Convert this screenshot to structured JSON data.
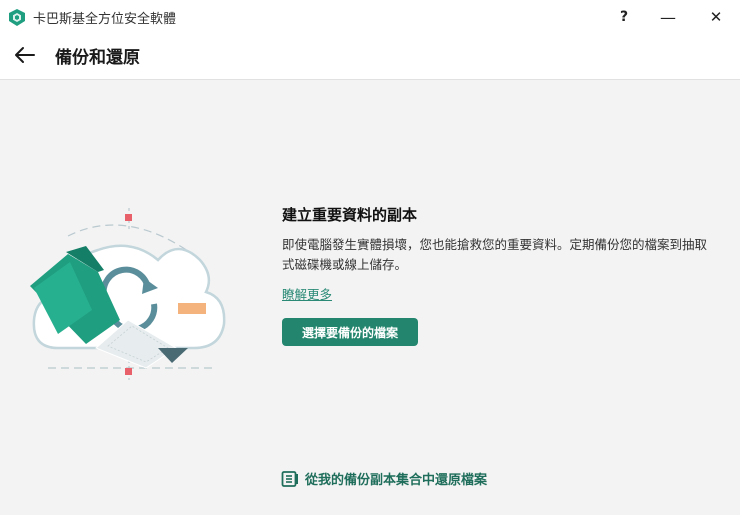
{
  "window": {
    "title": "卡巴斯基全方位安全軟體",
    "help_label": "?",
    "minimize_label": "—",
    "close_label": "✕"
  },
  "header": {
    "title": "備份和還原",
    "back_icon": "arrow-left-icon"
  },
  "main": {
    "heading": "建立重要資料的副本",
    "description": "即使電腦發生實體損壞，您也能搶救您的重要資料。定期備份您的檔案到抽取式磁碟機或線上儲存。",
    "learn_more": "瞭解更多",
    "primary_button": "選擇要備份的檔案",
    "restore_link": "從我的備份副本集合中還原檔案",
    "restore_icon": "backup-storage-icon"
  },
  "colors": {
    "accent": "#23856d",
    "link": "#2a8a76",
    "illustration_green": "#1f9e80",
    "illustration_orange": "#f4b27c",
    "illustration_pink": "#e8606a"
  }
}
